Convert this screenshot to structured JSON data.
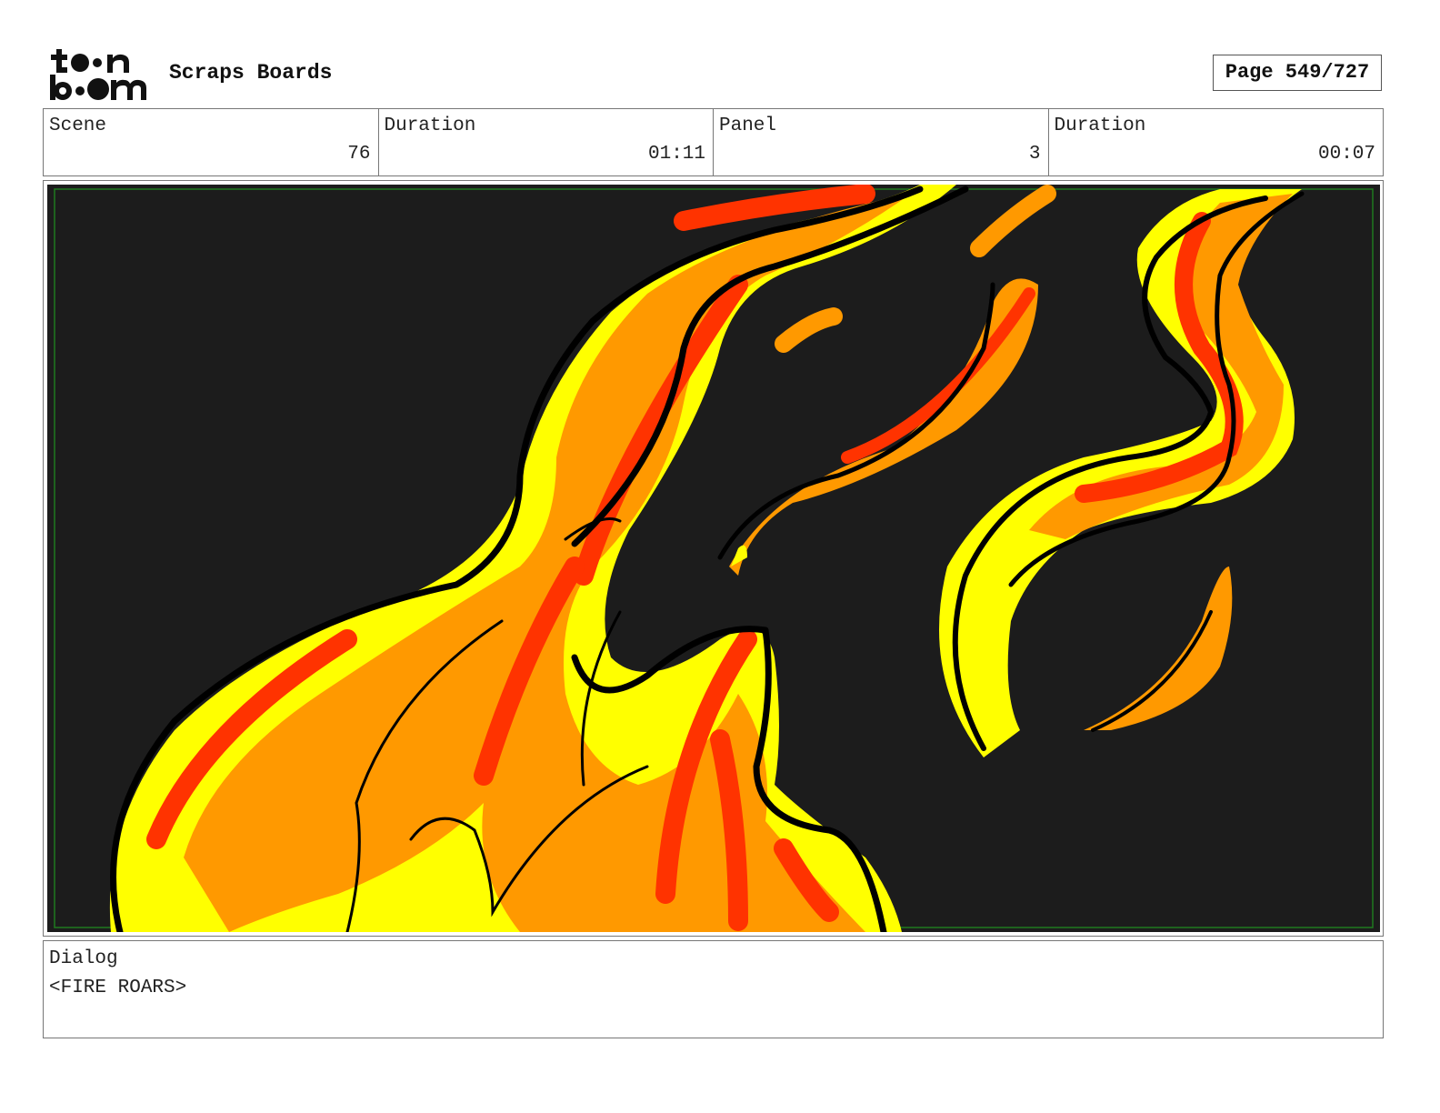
{
  "header": {
    "logo_text": "toon boom",
    "project_title": "Scraps Boards",
    "page_label": "Page 549/727"
  },
  "info": {
    "scene_label": "Scene",
    "scene_value": "76",
    "scene_duration_label": "Duration",
    "scene_duration_value": "01:11",
    "panel_label": "Panel",
    "panel_value": "3",
    "panel_duration_label": "Duration",
    "panel_duration_value": "00:07"
  },
  "panel": {
    "background_color": "#1c1c1c",
    "safe_frame_color": "#1f7a1f",
    "flame_colors": [
      "#ffff00",
      "#ff9900",
      "#ff3300",
      "#000000"
    ]
  },
  "dialog": {
    "label": "Dialog",
    "text": "<FIRE ROARS>"
  }
}
